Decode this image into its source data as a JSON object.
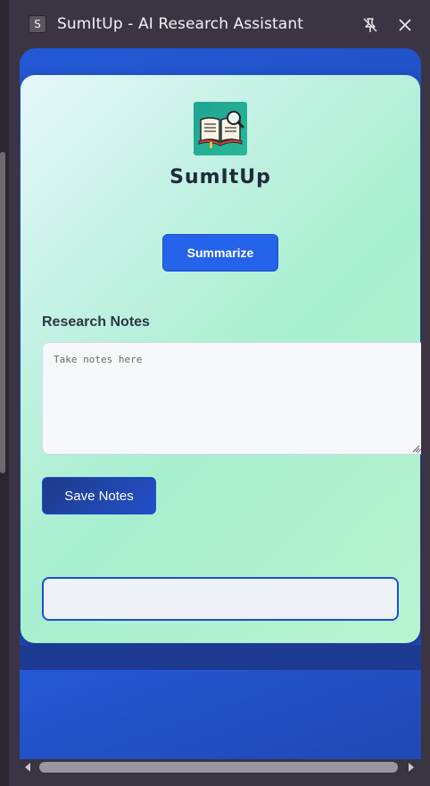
{
  "window": {
    "badge_letter": "S",
    "title": "SumItUp - AI Research Assistant"
  },
  "app": {
    "name": "SumItUp",
    "summarize_label": "Summarize",
    "notes_heading": "Research Notes",
    "notes_placeholder": "Take notes here",
    "notes_value": "",
    "save_label": "Save Notes",
    "summary_text": ""
  },
  "icons": {
    "pin": "unpin-icon",
    "close": "close-icon",
    "logo": "book-magnifier-icon"
  },
  "colors": {
    "primary_button": "#2563eb",
    "panel_blue": "#2253cf",
    "card_gradient_start": "#e6f7fb",
    "card_gradient_end": "#a8efcf"
  }
}
